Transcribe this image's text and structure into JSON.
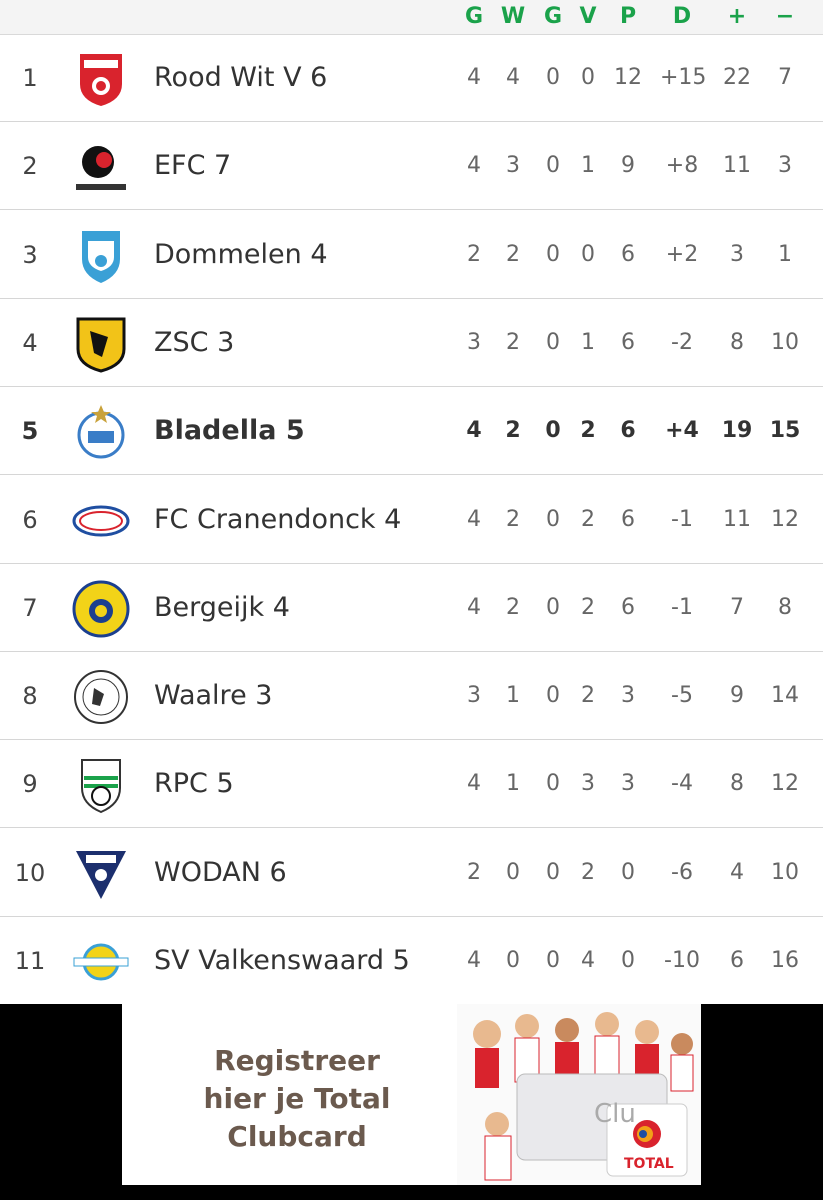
{
  "header": {
    "columns": [
      "G",
      "W",
      "G",
      "V",
      "P",
      "D",
      "+",
      "−"
    ]
  },
  "rows": [
    {
      "pos": "1",
      "team": "Rood Wit V 6",
      "logo": "roodwit-crest-icon",
      "bold": false,
      "stats": [
        "4",
        "4",
        "0",
        "0",
        "12",
        "+15",
        "22",
        "7"
      ]
    },
    {
      "pos": "2",
      "team": "EFC 7",
      "logo": "efc-crest-icon",
      "bold": false,
      "stats": [
        "4",
        "3",
        "0",
        "1",
        "9",
        "+8",
        "11",
        "3"
      ]
    },
    {
      "pos": "3",
      "team": "Dommelen 4",
      "logo": "dommelen-crest-icon",
      "bold": false,
      "stats": [
        "2",
        "2",
        "0",
        "0",
        "6",
        "+2",
        "3",
        "1"
      ]
    },
    {
      "pos": "4",
      "team": "ZSC 3",
      "logo": "zsc-crest-icon",
      "bold": false,
      "stats": [
        "3",
        "2",
        "0",
        "1",
        "6",
        "-2",
        "8",
        "10"
      ]
    },
    {
      "pos": "5",
      "team": "Bladella 5",
      "logo": "bladella-crest-icon",
      "bold": true,
      "stats": [
        "4",
        "2",
        "0",
        "2",
        "6",
        "+4",
        "19",
        "15"
      ]
    },
    {
      "pos": "6",
      "team": "FC Cranendonck 4",
      "logo": "cranendonck-crest-icon",
      "bold": false,
      "stats": [
        "4",
        "2",
        "0",
        "2",
        "6",
        "-1",
        "11",
        "12"
      ]
    },
    {
      "pos": "7",
      "team": "Bergeijk 4",
      "logo": "bergeijk-crest-icon",
      "bold": false,
      "stats": [
        "4",
        "2",
        "0",
        "2",
        "6",
        "-1",
        "7",
        "8"
      ]
    },
    {
      "pos": "8",
      "team": "Waalre 3",
      "logo": "waalre-crest-icon",
      "bold": false,
      "stats": [
        "3",
        "1",
        "0",
        "2",
        "3",
        "-5",
        "9",
        "14"
      ]
    },
    {
      "pos": "9",
      "team": "RPC 5",
      "logo": "rpc-crest-icon",
      "bold": false,
      "stats": [
        "4",
        "1",
        "0",
        "3",
        "3",
        "-4",
        "8",
        "12"
      ]
    },
    {
      "pos": "10",
      "team": "WODAN 6",
      "logo": "wodan-crest-icon",
      "bold": false,
      "stats": [
        "2",
        "0",
        "0",
        "2",
        "0",
        "-6",
        "4",
        "10"
      ]
    },
    {
      "pos": "11",
      "team": "SV Valkenswaard 5",
      "logo": "valkenswaard-crest-icon",
      "bold": false,
      "stats": [
        "4",
        "0",
        "0",
        "4",
        "0",
        "-10",
        "6",
        "16"
      ]
    }
  ],
  "ad": {
    "lines": [
      "Registreer",
      "hier je Total",
      "Clubcard"
    ],
    "card_text": "Clu",
    "brand": "TOTAL"
  },
  "colors": {
    "header_accent": "#1aa24a"
  }
}
